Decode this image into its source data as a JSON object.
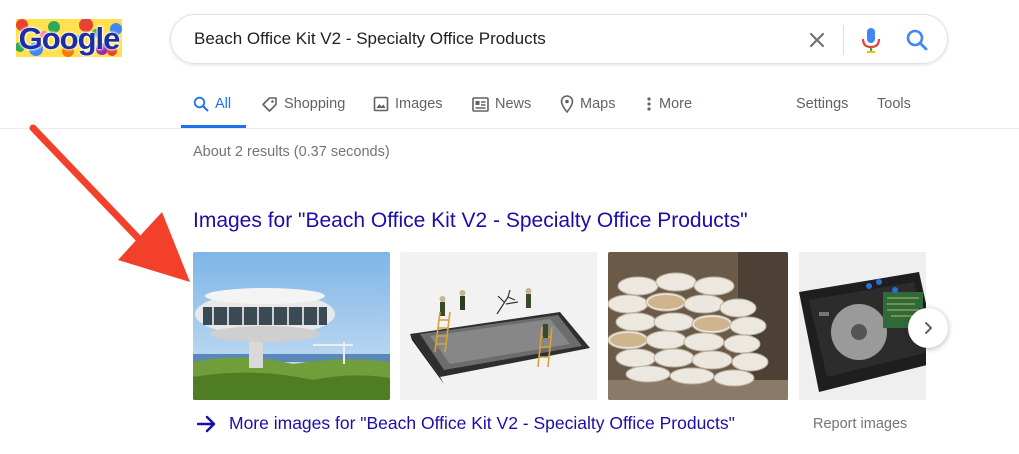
{
  "logo": {
    "text": "Google"
  },
  "search": {
    "query": "Beach Office Kit V2 - Specialty Office Products"
  },
  "tabs": [
    {
      "label": "All",
      "icon": "search-icon",
      "active": true
    },
    {
      "label": "Shopping",
      "icon": "tag-icon"
    },
    {
      "label": "Images",
      "icon": "image-icon"
    },
    {
      "label": "News",
      "icon": "news-icon"
    },
    {
      "label": "Maps",
      "icon": "map-pin-icon"
    },
    {
      "label": "More",
      "icon": "more-vert-icon"
    }
  ],
  "tools": {
    "settings": "Settings",
    "tools": "Tools"
  },
  "results": {
    "stats": "About 2 results (0.37 seconds)"
  },
  "images_section": {
    "heading": "Images for \"Beach Office Kit V2 - Specialty Office Products\"",
    "more_link": "More images for \"Beach Office Kit V2 - Specialty Office Products\"",
    "report": "Report images"
  },
  "colors": {
    "link": "#1a0dab",
    "accent": "#1a73e8",
    "muted": "#70757a",
    "annotation_arrow": "#f2402a"
  }
}
